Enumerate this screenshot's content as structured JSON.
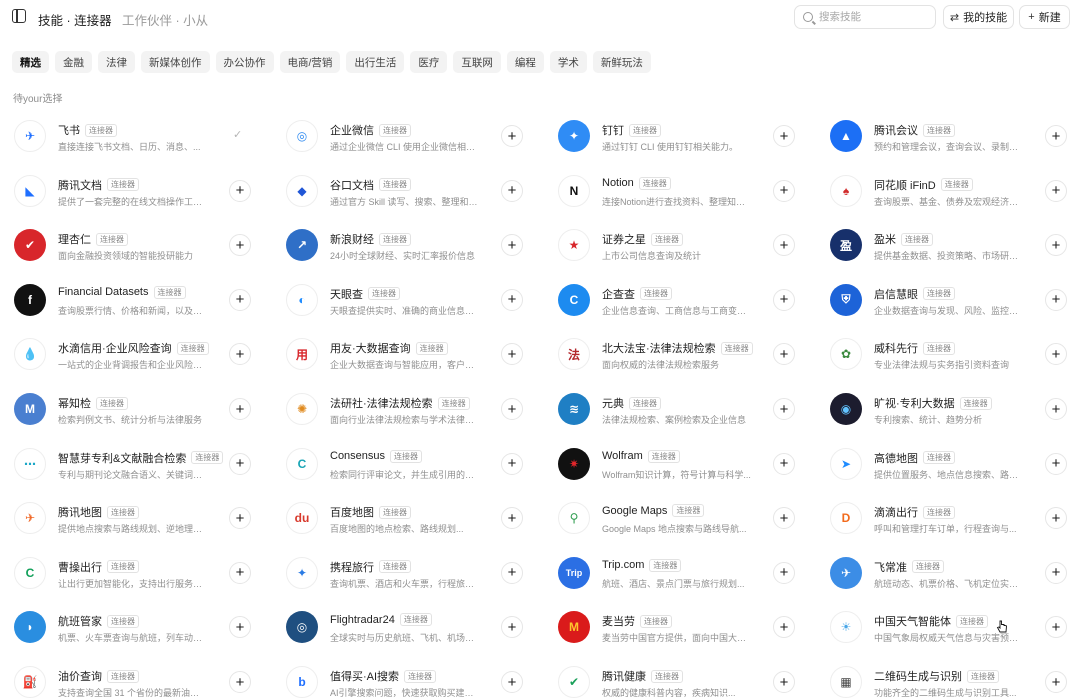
{
  "topbar": {
    "breadcrumb": "技能 · 连接器",
    "subtitle": "工作伙伴 · 小从",
    "search_placeholder": "搜索技能",
    "my_skills_label": "我的技能",
    "new_label": "新建"
  },
  "tabs": [
    "精选",
    "金融",
    "法律",
    "新媒体创作",
    "办公协作",
    "电商/营销",
    "出行生活",
    "医疗",
    "互联网",
    "编程",
    "学术",
    "新鲜玩法"
  ],
  "active_tab": "精选",
  "section_title": "待your选择",
  "badge_label": "连接器",
  "colors": {
    "accent": "#1677ff",
    "badge_border": "#e2e2e2"
  },
  "connectors": [
    {
      "name": "飞书",
      "desc": "直接连接飞书文档、日历、消息、...",
      "badge": "连接器",
      "added": true,
      "bg": "#ffffff",
      "fg": "#1f6fff",
      "glyph": "✈"
    },
    {
      "name": "企业微信",
      "desc": "通过企业微信 CLI 使用企业微信相关...",
      "badge": "连接器",
      "added": false,
      "bg": "#ffffff",
      "fg": "#2b88f0",
      "glyph": "◎"
    },
    {
      "name": "钉钉",
      "desc": "通过钉钉 CLI 使用钉钉相关能力。",
      "badge": "连接器",
      "added": false,
      "bg": "#2f8cf5",
      "fg": "#ffffff",
      "glyph": "✦"
    },
    {
      "name": "腾讯会议",
      "desc": "预约和管理会议，查询会议、录制、转...",
      "badge": "连接器",
      "added": false,
      "bg": "#1c6ff5",
      "fg": "#ffffff",
      "glyph": "▲"
    },
    {
      "name": "腾讯文档",
      "desc": "提供了一套完整的在线文档操作工具的...",
      "badge": "连接器",
      "added": false,
      "bg": "#ffffff",
      "fg": "#1f6fff",
      "glyph": "◣"
    },
    {
      "name": "谷口文档",
      "desc": "通过官方 Skill 读写、搜索、整理和管理...",
      "badge": "连接器",
      "added": false,
      "bg": "#ffffff",
      "fg": "#2056d6",
      "glyph": "◆"
    },
    {
      "name": "Notion",
      "desc": "连接Notion进行查找资料、整理知识...",
      "badge": "连接器",
      "added": false,
      "bg": "#ffffff",
      "fg": "#111111",
      "glyph": "N"
    },
    {
      "name": "同花顺 iFinD",
      "desc": "查询股票、基金、债券及宏观经济数据",
      "badge": "连接器",
      "added": false,
      "bg": "#ffffff",
      "fg": "#d12d2d",
      "glyph": "♠"
    },
    {
      "name": "理杏仁",
      "desc": "面向金融投资领域的智能投研能力",
      "badge": "连接器",
      "added": false,
      "bg": "#d8262b",
      "fg": "#ffffff",
      "glyph": "✔"
    },
    {
      "name": "新浪财经",
      "desc": "24小时全球财经、实时汇率报价信息",
      "badge": "连接器",
      "added": false,
      "bg": "#2f6fc7",
      "fg": "#ffffff",
      "glyph": "↗"
    },
    {
      "name": "证券之星",
      "desc": "上市公司信息查询及统计",
      "badge": "连接器",
      "added": false,
      "bg": "#ffffff",
      "fg": "#d8262b",
      "glyph": "★"
    },
    {
      "name": "盈米",
      "desc": "提供基金数据、投资策略、市场研究...",
      "badge": "连接器",
      "added": false,
      "bg": "#17306b",
      "fg": "#ffffff",
      "glyph": "盈"
    },
    {
      "name": "Financial Datasets",
      "desc": "查询股票行情、价格和新闻，以及加密...",
      "badge": "连接器",
      "added": false,
      "bg": "#111111",
      "fg": "#ffffff",
      "glyph": "f"
    },
    {
      "name": "天眼查",
      "desc": "天眼查提供实时、准确的商业信息，让...",
      "badge": "连接器",
      "added": false,
      "bg": "#ffffff",
      "fg": "#1f8cff",
      "glyph": "◐"
    },
    {
      "name": "企查查",
      "desc": "企业信息查询、工商信息与工商变更记...",
      "badge": "连接器",
      "added": false,
      "bg": "#1d8bf0",
      "fg": "#ffffff",
      "glyph": "C"
    },
    {
      "name": "启信慧眼",
      "desc": "企业数据查询与发现、风险、监控与报告",
      "badge": "连接器",
      "added": false,
      "bg": "#1d63d8",
      "fg": "#ffffff",
      "glyph": "⛨"
    },
    {
      "name": "水滴信用·企业风险查询",
      "desc": "一站式的企业背调报告和企业风险查询...",
      "badge": "连接器",
      "added": false,
      "bg": "#ffffff",
      "fg": "#1f8cff",
      "glyph": "💧"
    },
    {
      "name": "用友·大数据查询",
      "desc": "企业大数据查询与智能应用，客户洞...",
      "badge": "连接器",
      "added": false,
      "bg": "#ffffff",
      "fg": "#d8262b",
      "glyph": "用"
    },
    {
      "name": "北大法宝·法律法规检索",
      "desc": "面向权威的法律法规检索服务",
      "badge": "连接器",
      "added": false,
      "bg": "#ffffff",
      "fg": "#b3282d",
      "glyph": "法"
    },
    {
      "name": "威科先行",
      "desc": "专业法律法规与实务指引资料查询",
      "badge": "连接器",
      "added": false,
      "bg": "#ffffff",
      "fg": "#3b8a3e",
      "glyph": "✿"
    },
    {
      "name": "幂知检",
      "desc": "检索判例文书、统计分析与法律服务",
      "badge": "连接器",
      "added": false,
      "bg": "#4a7fd0",
      "fg": "#ffffff",
      "glyph": "M"
    },
    {
      "name": "法研社·法律法规检索",
      "desc": "面向行业法律法规检索与学术法律支持",
      "badge": "连接器",
      "added": false,
      "bg": "#ffffff",
      "fg": "#e08a1e",
      "glyph": "✺"
    },
    {
      "name": "元典",
      "desc": "法律法规检索、案例检索及企业信息",
      "badge": "连接器",
      "added": false,
      "bg": "#1f7fc4",
      "fg": "#ffffff",
      "glyph": "≋"
    },
    {
      "name": "旷视·专利大数据",
      "desc": "专利搜索、统计、趋势分析",
      "badge": "连接器",
      "added": false,
      "bg": "#1c1c2e",
      "fg": "#62c3ff",
      "glyph": "◉"
    },
    {
      "name": "智慧芽专利&文献融合检索",
      "desc": "专利与期刊论文融合语义、关键词、多...",
      "badge": "连接器",
      "added": false,
      "bg": "#ffffff",
      "fg": "#1aa7c7",
      "glyph": "⋯"
    },
    {
      "name": "Consensus",
      "desc": "检索同行评审论文，并生成引用的证...",
      "badge": "连接器",
      "added": false,
      "bg": "#ffffff",
      "fg": "#19a5b5",
      "glyph": "C"
    },
    {
      "name": "Wolfram",
      "desc": "Wolfram知识计算，符号计算与科学...",
      "badge": "连接器",
      "added": false,
      "bg": "#111111",
      "fg": "#e3262b",
      "glyph": "✷"
    },
    {
      "name": "高德地图",
      "desc": "提供位置服务、地点信息搜索、路径规...",
      "badge": "连接器",
      "added": false,
      "bg": "#ffffff",
      "fg": "#1f8cff",
      "glyph": "➤"
    },
    {
      "name": "腾讯地图",
      "desc": "提供地点搜索与路线规划、逆地理编码...",
      "badge": "连接器",
      "added": false,
      "bg": "#ffffff",
      "fg": "#f06a2a",
      "glyph": "✈"
    },
    {
      "name": "百度地图",
      "desc": "百度地图的地点检索、路线规划...",
      "badge": "连接器",
      "added": false,
      "bg": "#ffffff",
      "fg": "#d83a2d",
      "glyph": "du"
    },
    {
      "name": "Google Maps",
      "desc": "Google Maps 地点搜索与路线导航...",
      "badge": "连接器",
      "added": false,
      "bg": "#ffffff",
      "fg": "#2f9d4f",
      "glyph": "⚲"
    },
    {
      "name": "滴滴出行",
      "desc": "呼叫和管理打车订单，行程查询与...",
      "badge": "连接器",
      "added": false,
      "bg": "#ffffff",
      "fg": "#f26b1d",
      "glyph": "D"
    },
    {
      "name": "曹操出行",
      "desc": "让出行更加智能化，支持出行服务和智能...",
      "badge": "连接器",
      "added": false,
      "bg": "#ffffff",
      "fg": "#12a05a",
      "glyph": "C"
    },
    {
      "name": "携程旅行",
      "desc": "查询机票、酒店和火车票，行程旅游...",
      "badge": "连接器",
      "added": false,
      "bg": "#ffffff",
      "fg": "#2a7be4",
      "glyph": "✦"
    },
    {
      "name": "Trip.com",
      "desc": "航班、酒店、景点门票与旅行规划...",
      "badge": "连接器",
      "added": false,
      "bg": "#2b6fe4",
      "fg": "#ffffff",
      "glyph": "Trip"
    },
    {
      "name": "飞常准",
      "desc": "航班动态、机票价格、飞机定位实时...",
      "badge": "连接器",
      "added": false,
      "bg": "#3c8de6",
      "fg": "#ffffff",
      "glyph": "✈"
    },
    {
      "name": "航班管家",
      "desc": "机票、火车票查询与航班，列车动态追踪",
      "badge": "连接器",
      "added": false,
      "bg": "#2a8ee0",
      "fg": "#ffffff",
      "glyph": "◗"
    },
    {
      "name": "Flightradar24",
      "desc": "全球实时与历史航班、飞机、机场动态...",
      "badge": "连接器",
      "added": false,
      "bg": "#1f4f80",
      "fg": "#ffffff",
      "glyph": "◎"
    },
    {
      "name": "麦当劳",
      "desc": "麦当劳中国官方提供，面向中国大陆地区...",
      "badge": "连接器",
      "added": false,
      "bg": "#da1b1b",
      "fg": "#ffc72c",
      "glyph": "M"
    },
    {
      "name": "中国天气智能体",
      "desc": "中国气象局权威天气信息与灾害预警...",
      "badge": "连接器",
      "added": false,
      "bg": "#ffffff",
      "fg": "#4aa7e8",
      "glyph": "☀"
    },
    {
      "name": "油价查询",
      "desc": "支持查询全国 31 个省份的最新油价信...",
      "badge": "连接器",
      "added": false,
      "bg": "#ffffff",
      "fg": "#555555",
      "glyph": "⛽"
    },
    {
      "name": "值得买·AI搜索",
      "desc": "AI引擎搜索问题，快速获取购买建议...",
      "badge": "连接器",
      "added": false,
      "bg": "#ffffff",
      "fg": "#1f6fff",
      "glyph": "b"
    },
    {
      "name": "腾讯健康",
      "desc": "权威的健康科普内容，疾病知识...",
      "badge": "连接器",
      "added": false,
      "bg": "#ffffff",
      "fg": "#1aa05a",
      "glyph": "✔"
    },
    {
      "name": "二维码生成与识别",
      "desc": "功能齐全的二维码生成与识别工具...",
      "badge": "连接器",
      "added": false,
      "bg": "#ffffff",
      "fg": "#444444",
      "glyph": "▦"
    }
  ]
}
